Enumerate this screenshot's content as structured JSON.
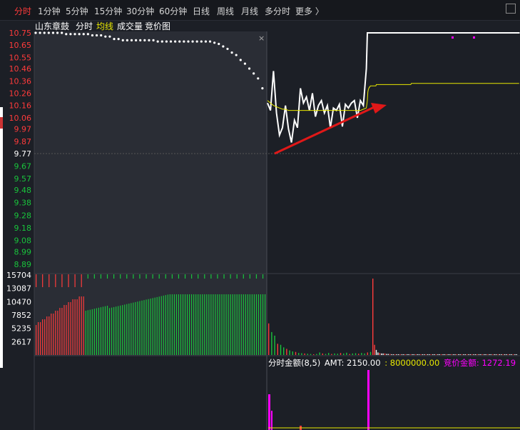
{
  "toolbar": {
    "tabs": [
      {
        "label": "分时",
        "active": true
      },
      {
        "label": "1分钟"
      },
      {
        "label": "5分钟"
      },
      {
        "label": "15分钟"
      },
      {
        "label": "30分钟"
      },
      {
        "label": "60分钟"
      },
      {
        "label": "日线"
      },
      {
        "label": "周线"
      },
      {
        "label": "月线"
      },
      {
        "label": "多分时"
      },
      {
        "label": "更多 〉"
      }
    ]
  },
  "subbar": {
    "stock_name": "山东章鼓",
    "items": [
      "分时",
      "均线",
      "成交量",
      "竞价图"
    ]
  },
  "colors": {
    "up": "#ff3b3b",
    "down": "#19c43c",
    "price_line": "#ffffff",
    "avg_line": "#e8e800",
    "magenta": "#ff00ff",
    "arrow": "#e01818"
  },
  "chart_data": [
    {
      "type": "line",
      "panel": "price",
      "y_ticks_up": [
        "10.75",
        "10.65",
        "10.55",
        "10.46",
        "10.36",
        "10.26",
        "10.16",
        "10.06",
        "9.97",
        "9.87"
      ],
      "y_tick_base": "9.77",
      "y_ticks_down": [
        "9.67",
        "9.57",
        "9.48",
        "9.38",
        "9.28",
        "9.18",
        "9.08",
        "8.99",
        "8.89"
      ],
      "ylim": [
        8.89,
        10.75
      ],
      "base_price": 9.77,
      "series": [
        {
          "key": "auction_price",
          "color": "#ffffff",
          "values": [
            10.75,
            10.75,
            10.75,
            10.75,
            10.75,
            10.75,
            10.75,
            10.74,
            10.74,
            10.74,
            10.74,
            10.74,
            10.74,
            10.73,
            10.73,
            10.73,
            10.72,
            10.72,
            10.7,
            10.7,
            10.69,
            10.69,
            10.69,
            10.69,
            10.69,
            10.69,
            10.69,
            10.69,
            10.68,
            10.68,
            10.68,
            10.68,
            10.68,
            10.68,
            10.68,
            10.68,
            10.68,
            10.68,
            10.68,
            10.68,
            10.68,
            10.67,
            10.66,
            10.64,
            10.62,
            10.59,
            10.57,
            10.53,
            10.5,
            10.46,
            10.42,
            10.38,
            10.3
          ]
        },
        {
          "key": "price",
          "color": "#ffffff",
          "values": [
            10.18,
            10.12,
            10.44,
            10.1,
            9.92,
            9.98,
            10.16,
            9.97,
            9.86,
            10.04,
            9.98,
            10.3,
            10.18,
            10.23,
            10.12,
            10.26,
            10.07,
            10.16,
            10.2,
            10.1,
            10.16,
            9.98,
            10.14,
            10.12,
            10.17,
            9.99,
            10.17,
            10.14,
            10.18,
            10.2,
            10.06,
            10.2,
            10.16,
            10.46,
            10.75,
            10.75,
            10.75,
            10.75,
            10.75,
            10.75,
            10.75,
            10.75,
            10.75,
            10.75,
            10.75,
            10.75,
            10.75,
            10.75,
            10.75,
            10.75,
            10.75,
            10.75,
            10.75,
            10.75,
            10.75,
            10.75,
            10.75,
            10.75,
            10.75,
            10.75,
            10.75,
            10.75,
            10.75,
            10.75,
            10.75,
            10.75,
            10.75,
            10.75,
            10.75,
            10.75,
            10.75,
            10.75,
            10.75,
            10.75,
            10.75,
            10.75,
            10.75,
            10.75,
            10.75,
            10.75,
            10.75,
            10.75,
            10.75,
            10.75,
            10.75,
            10.75,
            10.75,
            10.75,
            10.75,
            10.75,
            10.75,
            10.75,
            10.75,
            10.75,
            10.75,
            10.75,
            10.75,
            10.75,
            10.75,
            10.75,
            10.75,
            10.75,
            10.75,
            10.75,
            10.75,
            10.75,
            10.75,
            10.75,
            10.75,
            10.75,
            10.75,
            10.75,
            10.75,
            10.75,
            10.75,
            10.75,
            10.75,
            10.75,
            10.75,
            10.75,
            10.75,
            10.75,
            10.75,
            10.75,
            10.75,
            10.75,
            10.75,
            10.75,
            10.75,
            10.75,
            10.75,
            10.75,
            10.75,
            10.75,
            10.75,
            10.75,
            10.75,
            10.75,
            10.75,
            10.75,
            10.75,
            10.75,
            10.75,
            10.75,
            10.75,
            10.75,
            10.75,
            10.75,
            10.75,
            10.75,
            10.75,
            10.75,
            10.75,
            10.75,
            10.75,
            10.75,
            10.75,
            10.75,
            10.75,
            10.75,
            10.75,
            10.75,
            10.75,
            10.75,
            10.75,
            10.75,
            10.75,
            10.75,
            10.75,
            10.75,
            10.75,
            10.75,
            10.75,
            10.75,
            10.75,
            10.75,
            10.75,
            10.75,
            10.75,
            10.75,
            10.75,
            10.75,
            10.75,
            10.75,
            10.75,
            10.75,
            10.75,
            10.75,
            10.75,
            10.75,
            10.75,
            10.75,
            10.75,
            10.75,
            10.75,
            10.75,
            10.75,
            10.75,
            10.75,
            10.75,
            10.75,
            10.75,
            10.75,
            10.75,
            10.75,
            10.75,
            10.75,
            10.75,
            10.75,
            10.75,
            10.75,
            10.75,
            10.75,
            10.75,
            10.75,
            10.75,
            10.75,
            10.75,
            10.75,
            10.75,
            10.75,
            10.75,
            10.75,
            10.75,
            10.75,
            10.75,
            10.75,
            10.75,
            10.75,
            10.75,
            10.75,
            10.75,
            10.75,
            10.75,
            10.75,
            10.75,
            10.75,
            10.75,
            10.75,
            10.75,
            10.75,
            10.75,
            10.75,
            10.75,
            10.75,
            10.75,
            10.75,
            10.75,
            10.75,
            10.75,
            10.75,
            10.75,
            10.75,
            10.75,
            10.75,
            10.75,
            10.75,
            10.75,
            10.75,
            10.75,
            10.75,
            10.75,
            10.75,
            10.75,
            10.75,
            10.75,
            10.75,
            10.75,
            10.75,
            10.75,
            10.75,
            10.75,
            10.75,
            10.75,
            10.75,
            10.75,
            10.75,
            10.75,
            10.75,
            10.75,
            10.75,
            10.75,
            10.75,
            10.75,
            10.75,
            10.75,
            10.75,
            10.75,
            10.75,
            10.75,
            10.75,
            10.75,
            10.75,
            10.75,
            10.75,
            10.75,
            10.75,
            10.75,
            10.75,
            10.75,
            10.75,
            10.75,
            10.75,
            10.75,
            10.75,
            10.75,
            10.75,
            10.75,
            10.75,
            10.75,
            10.75,
            10.75,
            10.75,
            10.75,
            10.75,
            10.75,
            10.75,
            10.75,
            10.75,
            10.75,
            10.75,
            10.75,
            10.75,
            10.75,
            10.75,
            10.75,
            10.75,
            10.75,
            10.75,
            10.75,
            10.75,
            10.75,
            10.75,
            10.75,
            10.75,
            10.75,
            10.75,
            10.75,
            10.75,
            10.75
          ]
        },
        {
          "key": "avg",
          "color": "#e8e800",
          "values": [
            10.2,
            10.18,
            10.16,
            10.15,
            10.14,
            10.13,
            10.13,
            10.12,
            10.12,
            10.12,
            10.12,
            10.12,
            10.12,
            10.12,
            10.12,
            10.12,
            10.12,
            10.12,
            10.12,
            10.12,
            10.12,
            10.12,
            10.12,
            10.12,
            10.12,
            10.12,
            10.12,
            10.12,
            10.12,
            10.12,
            10.12,
            10.12,
            10.13,
            10.14,
            10.2,
            10.27,
            10.29,
            10.3,
            10.31,
            10.31,
            10.32,
            10.32,
            10.32,
            10.32,
            10.32,
            10.32,
            10.32,
            10.32,
            10.32,
            10.32,
            10.32,
            10.32,
            10.33,
            10.33,
            10.33,
            10.33,
            10.33,
            10.33,
            10.33,
            10.33,
            10.33,
            10.33,
            10.33,
            10.33,
            10.33,
            10.33,
            10.33,
            10.33,
            10.33,
            10.33,
            10.33,
            10.33,
            10.33,
            10.33,
            10.33,
            10.33,
            10.33,
            10.33,
            10.33,
            10.33,
            10.33,
            10.33,
            10.33,
            10.33,
            10.33,
            10.33,
            10.33,
            10.33,
            10.33,
            10.33,
            10.33,
            10.33,
            10.33,
            10.33,
            10.33,
            10.33,
            10.33,
            10.33,
            10.33,
            10.33,
            10.33,
            10.33,
            10.33,
            10.33,
            10.33,
            10.33,
            10.33,
            10.33,
            10.33,
            10.33,
            10.33,
            10.33,
            10.33,
            10.33,
            10.33,
            10.33,
            10.33,
            10.33,
            10.33,
            10.33,
            10.33,
            10.33,
            10.34,
            10.34,
            10.34,
            10.34,
            10.34,
            10.34,
            10.34,
            10.34,
            10.34,
            10.34,
            10.34,
            10.34,
            10.34,
            10.34,
            10.34,
            10.34,
            10.34,
            10.34,
            10.34,
            10.34,
            10.34,
            10.34,
            10.34,
            10.34,
            10.34,
            10.34,
            10.34,
            10.34,
            10.34,
            10.34,
            10.34,
            10.34,
            10.34,
            10.34,
            10.34,
            10.34,
            10.34,
            10.34,
            10.34,
            10.34,
            10.34,
            10.34,
            10.34,
            10.34,
            10.34,
            10.34,
            10.34,
            10.34,
            10.34,
            10.34,
            10.34,
            10.34,
            10.34,
            10.34,
            10.34,
            10.34,
            10.34,
            10.34,
            10.34,
            10.34,
            10.34,
            10.34,
            10.34,
            10.34,
            10.34,
            10.34,
            10.34,
            10.34,
            10.34,
            10.34,
            10.34,
            10.34,
            10.34,
            10.34,
            10.34,
            10.34,
            10.34,
            10.34,
            10.34,
            10.34,
            10.34,
            10.34,
            10.34,
            10.34,
            10.34,
            10.34,
            10.34,
            10.34,
            10.34,
            10.34,
            10.34,
            10.34,
            10.34,
            10.34,
            10.34,
            10.34,
            10.34,
            10.34,
            10.34,
            10.34,
            10.34,
            10.34,
            10.34,
            10.34,
            10.34,
            10.34,
            10.34,
            10.34,
            10.34,
            10.34,
            10.34,
            10.34,
            10.34,
            10.34,
            10.34,
            10.34,
            10.34,
            10.34,
            10.34,
            10.34,
            10.34,
            10.34,
            10.34,
            10.34,
            10.34,
            10.34,
            10.34,
            10.34,
            10.34,
            10.34,
            10.34,
            10.34,
            10.34,
            10.34,
            10.34,
            10.34,
            10.34,
            10.34,
            10.34,
            10.34,
            10.34,
            10.34,
            10.34,
            10.34,
            10.34,
            10.34,
            10.34,
            10.34,
            10.34,
            10.34,
            10.34,
            10.34,
            10.34,
            10.34,
            10.34,
            10.34,
            10.34,
            10.34,
            10.34,
            10.34,
            10.34,
            10.34,
            10.34,
            10.34,
            10.34,
            10.34,
            10.34,
            10.34,
            10.34,
            10.34,
            10.34,
            10.34,
            10.34,
            10.34,
            10.34,
            10.34,
            10.34,
            10.34,
            10.34,
            10.34,
            10.34,
            10.34,
            10.34,
            10.34,
            10.34,
            10.34,
            10.34,
            10.34,
            10.34,
            10.34,
            10.34,
            10.34,
            10.34,
            10.34,
            10.34,
            10.34,
            10.34,
            10.34,
            10.34,
            10.34,
            10.34,
            10.34,
            10.34,
            10.34,
            10.34,
            10.34,
            10.34,
            10.34,
            10.34,
            10.34,
            10.34,
            10.34,
            10.34,
            10.34,
            10.34,
            10.34,
            10.34
          ]
        }
      ],
      "annotation": {
        "type": "arrow",
        "color": "#e01818",
        "from_price": 9.77,
        "to_price": 10.16
      }
    },
    {
      "type": "bar",
      "panel": "volume",
      "y_ticks": [
        "15704",
        "13087",
        "10470",
        "7852",
        "5235",
        "2617"
      ],
      "ylim": [
        0,
        15704
      ],
      "auction_bars": {
        "up_side_red": [
          3,
          4,
          4,
          5,
          5,
          6,
          6,
          7,
          7,
          8,
          8,
          9,
          9,
          10,
          10,
          11,
          11,
          12,
          12,
          12,
          13,
          13,
          13
        ],
        "green": [
          13,
          13,
          13,
          13,
          13,
          13,
          13,
          13,
          13,
          13,
          13,
          12,
          12,
          12,
          12,
          12,
          12,
          12,
          12,
          12,
          12,
          12,
          12,
          12,
          12,
          12,
          12,
          12,
          12,
          12,
          12,
          12,
          12,
          12,
          12,
          12,
          12,
          12,
          12,
          12,
          12,
          12,
          12,
          12,
          12,
          12,
          12,
          12,
          12,
          12,
          12,
          12,
          12,
          12,
          12,
          12,
          12,
          12,
          12,
          12,
          12,
          12,
          12,
          12,
          12,
          12,
          12,
          12,
          12,
          12,
          12,
          12,
          12,
          12,
          12,
          12,
          12,
          12,
          12,
          12,
          12,
          12,
          12,
          12
        ]
      },
      "trading_volume": [
        6200,
        4500,
        3800,
        2200,
        2000,
        1500,
        1200,
        900,
        700,
        600,
        400,
        350,
        300,
        250,
        200,
        150,
        200,
        500,
        300,
        200,
        400,
        200,
        300,
        250,
        400,
        300,
        450,
        200,
        300,
        350,
        250,
        400,
        300,
        500,
        600,
        15000,
        2000,
        1000,
        500,
        400,
        300,
        300,
        300,
        200,
        200,
        200,
        150,
        150,
        150,
        150,
        150,
        150,
        150,
        150,
        150,
        150,
        150,
        150,
        150,
        150,
        150,
        150,
        150,
        150,
        150,
        150,
        150,
        150,
        150,
        150,
        150,
        150,
        150,
        150,
        150,
        150,
        150,
        150,
        150,
        150,
        150,
        150,
        150,
        150,
        150,
        150,
        150,
        150,
        150,
        150,
        150,
        150,
        150,
        150,
        150,
        150,
        150,
        150,
        150,
        150,
        150,
        150,
        150,
        150,
        150,
        150,
        150,
        150,
        150,
        150,
        150,
        150,
        150,
        150,
        150,
        150,
        150,
        150,
        150,
        150
      ]
    },
    {
      "type": "bar",
      "panel": "amount",
      "label": "分时金额(8,5)",
      "amt_label": "AMT: 2150.00",
      "amt2_label": ": 8000000.00",
      "auction_amount_label": "竞价金额: 1272.19",
      "trailing_label": "竞"
    }
  ]
}
